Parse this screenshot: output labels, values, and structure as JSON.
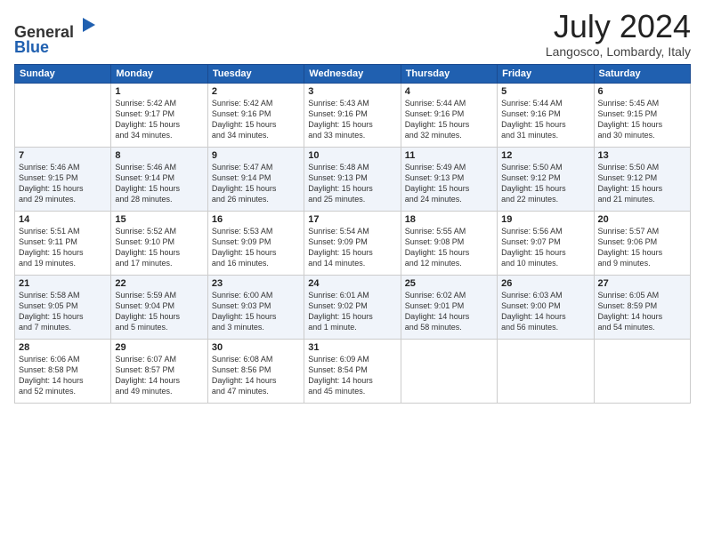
{
  "header": {
    "logo_line1": "General",
    "logo_line2": "Blue",
    "month": "July 2024",
    "location": "Langosco, Lombardy, Italy"
  },
  "weekdays": [
    "Sunday",
    "Monday",
    "Tuesday",
    "Wednesday",
    "Thursday",
    "Friday",
    "Saturday"
  ],
  "weeks": [
    [
      {
        "day": "",
        "info": ""
      },
      {
        "day": "1",
        "info": "Sunrise: 5:42 AM\nSunset: 9:17 PM\nDaylight: 15 hours\nand 34 minutes."
      },
      {
        "day": "2",
        "info": "Sunrise: 5:42 AM\nSunset: 9:16 PM\nDaylight: 15 hours\nand 34 minutes."
      },
      {
        "day": "3",
        "info": "Sunrise: 5:43 AM\nSunset: 9:16 PM\nDaylight: 15 hours\nand 33 minutes."
      },
      {
        "day": "4",
        "info": "Sunrise: 5:44 AM\nSunset: 9:16 PM\nDaylight: 15 hours\nand 32 minutes."
      },
      {
        "day": "5",
        "info": "Sunrise: 5:44 AM\nSunset: 9:16 PM\nDaylight: 15 hours\nand 31 minutes."
      },
      {
        "day": "6",
        "info": "Sunrise: 5:45 AM\nSunset: 9:15 PM\nDaylight: 15 hours\nand 30 minutes."
      }
    ],
    [
      {
        "day": "7",
        "info": "Sunrise: 5:46 AM\nSunset: 9:15 PM\nDaylight: 15 hours\nand 29 minutes."
      },
      {
        "day": "8",
        "info": "Sunrise: 5:46 AM\nSunset: 9:14 PM\nDaylight: 15 hours\nand 28 minutes."
      },
      {
        "day": "9",
        "info": "Sunrise: 5:47 AM\nSunset: 9:14 PM\nDaylight: 15 hours\nand 26 minutes."
      },
      {
        "day": "10",
        "info": "Sunrise: 5:48 AM\nSunset: 9:13 PM\nDaylight: 15 hours\nand 25 minutes."
      },
      {
        "day": "11",
        "info": "Sunrise: 5:49 AM\nSunset: 9:13 PM\nDaylight: 15 hours\nand 24 minutes."
      },
      {
        "day": "12",
        "info": "Sunrise: 5:50 AM\nSunset: 9:12 PM\nDaylight: 15 hours\nand 22 minutes."
      },
      {
        "day": "13",
        "info": "Sunrise: 5:50 AM\nSunset: 9:12 PM\nDaylight: 15 hours\nand 21 minutes."
      }
    ],
    [
      {
        "day": "14",
        "info": "Sunrise: 5:51 AM\nSunset: 9:11 PM\nDaylight: 15 hours\nand 19 minutes."
      },
      {
        "day": "15",
        "info": "Sunrise: 5:52 AM\nSunset: 9:10 PM\nDaylight: 15 hours\nand 17 minutes."
      },
      {
        "day": "16",
        "info": "Sunrise: 5:53 AM\nSunset: 9:09 PM\nDaylight: 15 hours\nand 16 minutes."
      },
      {
        "day": "17",
        "info": "Sunrise: 5:54 AM\nSunset: 9:09 PM\nDaylight: 15 hours\nand 14 minutes."
      },
      {
        "day": "18",
        "info": "Sunrise: 5:55 AM\nSunset: 9:08 PM\nDaylight: 15 hours\nand 12 minutes."
      },
      {
        "day": "19",
        "info": "Sunrise: 5:56 AM\nSunset: 9:07 PM\nDaylight: 15 hours\nand 10 minutes."
      },
      {
        "day": "20",
        "info": "Sunrise: 5:57 AM\nSunset: 9:06 PM\nDaylight: 15 hours\nand 9 minutes."
      }
    ],
    [
      {
        "day": "21",
        "info": "Sunrise: 5:58 AM\nSunset: 9:05 PM\nDaylight: 15 hours\nand 7 minutes."
      },
      {
        "day": "22",
        "info": "Sunrise: 5:59 AM\nSunset: 9:04 PM\nDaylight: 15 hours\nand 5 minutes."
      },
      {
        "day": "23",
        "info": "Sunrise: 6:00 AM\nSunset: 9:03 PM\nDaylight: 15 hours\nand 3 minutes."
      },
      {
        "day": "24",
        "info": "Sunrise: 6:01 AM\nSunset: 9:02 PM\nDaylight: 15 hours\nand 1 minute."
      },
      {
        "day": "25",
        "info": "Sunrise: 6:02 AM\nSunset: 9:01 PM\nDaylight: 14 hours\nand 58 minutes."
      },
      {
        "day": "26",
        "info": "Sunrise: 6:03 AM\nSunset: 9:00 PM\nDaylight: 14 hours\nand 56 minutes."
      },
      {
        "day": "27",
        "info": "Sunrise: 6:05 AM\nSunset: 8:59 PM\nDaylight: 14 hours\nand 54 minutes."
      }
    ],
    [
      {
        "day": "28",
        "info": "Sunrise: 6:06 AM\nSunset: 8:58 PM\nDaylight: 14 hours\nand 52 minutes."
      },
      {
        "day": "29",
        "info": "Sunrise: 6:07 AM\nSunset: 8:57 PM\nDaylight: 14 hours\nand 49 minutes."
      },
      {
        "day": "30",
        "info": "Sunrise: 6:08 AM\nSunset: 8:56 PM\nDaylight: 14 hours\nand 47 minutes."
      },
      {
        "day": "31",
        "info": "Sunrise: 6:09 AM\nSunset: 8:54 PM\nDaylight: 14 hours\nand 45 minutes."
      },
      {
        "day": "",
        "info": ""
      },
      {
        "day": "",
        "info": ""
      },
      {
        "day": "",
        "info": ""
      }
    ]
  ]
}
